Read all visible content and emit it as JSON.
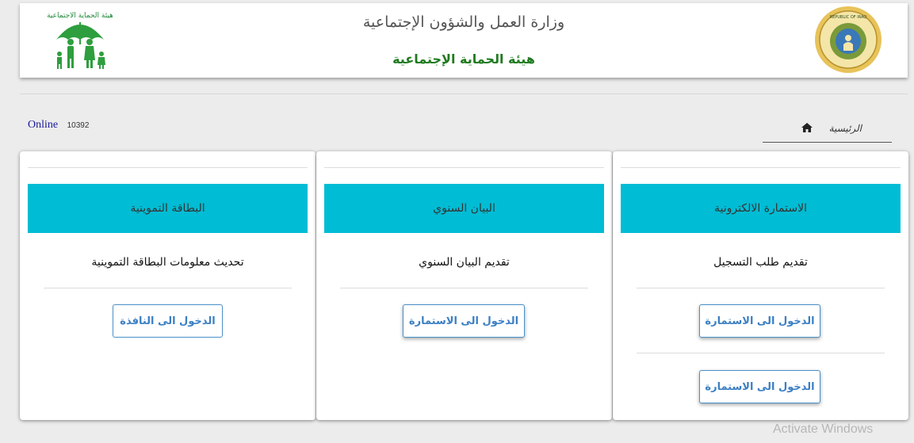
{
  "header": {
    "ministry_title": "وزارة العمل والشؤون الإجتماعية",
    "authority_title": "هيئة الحماية الإجتماعية",
    "left_logo_text": "هيئة الحماية الاجتماعية",
    "right_logo_text": "REPUBLIC OF IRAQ"
  },
  "infobar": {
    "online_label": "Online",
    "online_count": "10392",
    "home_label": "الرئيسية"
  },
  "cards": [
    {
      "header": "الاستمارة الالكترونية",
      "subtitle": "تقديم طلب التسجيل",
      "buttons": [
        "الدخول الى الاستمارة",
        "الدخول الى الاستمارة"
      ]
    },
    {
      "header": "البيان السنوي",
      "subtitle": "تقديم البيان السنوي",
      "buttons": [
        "الدخول الى الاستمارة"
      ]
    },
    {
      "header": "البطاقة التموينية",
      "subtitle": "تحديث معلومات البطاقة التموينية",
      "buttons": [
        "الدخول الى النافذة"
      ]
    }
  ],
  "colors": {
    "card_header": "#00bcd4",
    "button_text": "#3b7fc4",
    "authority_green": "#1f7a1f"
  },
  "watermark": "Activate Windows"
}
